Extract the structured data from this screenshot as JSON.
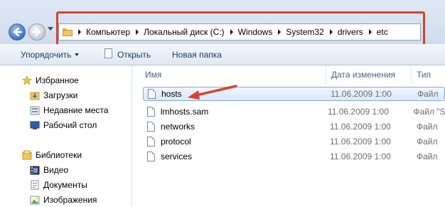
{
  "address_bar": {
    "breadcrumbs": [
      "Компьютер",
      "Локальный диск (C:)",
      "Windows",
      "System32",
      "drivers",
      "etc"
    ]
  },
  "toolbar": {
    "organize_label": "Упорядочить",
    "open_label": "Открыть",
    "new_folder_label": "Новая папка"
  },
  "nav_pane": {
    "favorites": {
      "label": "Избранное",
      "items": [
        "Загрузки",
        "Недавние места",
        "Рабочий стол"
      ]
    },
    "libraries": {
      "label": "Библиотеки",
      "items": [
        "Видео",
        "Документы",
        "Изображения"
      ]
    }
  },
  "file_list": {
    "columns": {
      "name": "Имя",
      "date": "Дата изменения",
      "type": "Тип"
    },
    "rows": [
      {
        "name": "hosts",
        "date": "11.06.2009 1:00",
        "type": "Файл",
        "selected": true
      },
      {
        "name": "lmhosts.sam",
        "date": "11.06.2009 1:00",
        "type": "Файл \"S"
      },
      {
        "name": "networks",
        "date": "11.06.2009 1:00",
        "type": "Файл"
      },
      {
        "name": "protocol",
        "date": "11.06.2009 1:00",
        "type": "Файл"
      },
      {
        "name": "services",
        "date": "11.06.2009 1:00",
        "type": "Файл"
      }
    ]
  },
  "annotation_color": "#d9432a",
  "selection_color": "#84acdd"
}
